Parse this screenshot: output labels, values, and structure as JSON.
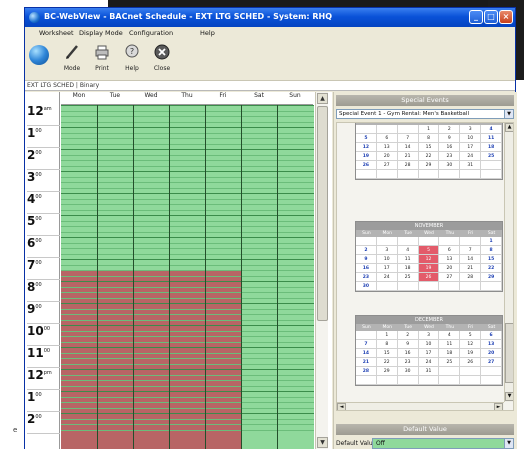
{
  "window": {
    "title": "BC-WebView - BACnet Schedule - EXT LTG SCHED - System: RHQ",
    "min": "_",
    "max": "□",
    "close": "×"
  },
  "menu": [
    "Worksheet",
    "Display Mode",
    "Configuration",
    "Help"
  ],
  "toolbar": [
    {
      "label": "Mode",
      "icon": "pencil-icon"
    },
    {
      "label": "Print",
      "icon": "printer-icon"
    },
    {
      "label": "Help",
      "icon": "help-icon"
    },
    {
      "label": "Close",
      "icon": "close-circle-icon"
    }
  ],
  "tab": "EXT LTG SCHED | Binary",
  "schedule": {
    "days": [
      "Mon",
      "Tue",
      "Wed",
      "Thu",
      "Fri",
      "Sat",
      "Sun"
    ],
    "times": [
      {
        "h": "12",
        "s": "am"
      },
      {
        "h": "1",
        "s": "00"
      },
      {
        "h": "2",
        "s": "00"
      },
      {
        "h": "3",
        "s": "00"
      },
      {
        "h": "4",
        "s": "00"
      },
      {
        "h": "5",
        "s": "00"
      },
      {
        "h": "6",
        "s": "00"
      },
      {
        "h": "7",
        "s": "00"
      },
      {
        "h": "8",
        "s": "00"
      },
      {
        "h": "9",
        "s": "00"
      },
      {
        "h": "10",
        "s": "00"
      },
      {
        "h": "11",
        "s": "00"
      },
      {
        "h": "12",
        "s": "pm"
      },
      {
        "h": "1",
        "s": "00"
      },
      {
        "h": "2",
        "s": "00"
      }
    ],
    "on_color": "#8fd99b",
    "event_color": "#b86565",
    "event_days": [
      "Mon",
      "Tue",
      "Wed",
      "Thu",
      "Fri"
    ],
    "event_start": "7:30"
  },
  "side_letter": "e",
  "special_events": {
    "header": "Special Events",
    "selected": "Special Event 1 - Gym Rental: Men's Basketball",
    "weekday_labels": [
      "Sun",
      "Mon",
      "Tue",
      "Wed",
      "Thu",
      "Fri",
      "Sat"
    ],
    "months": [
      {
        "name": "",
        "weeks": [
          [
            "",
            "",
            "",
            "1",
            "2",
            "3",
            "4"
          ],
          [
            "5",
            "6",
            "7",
            "8",
            "9",
            "10",
            "11"
          ],
          [
            "12",
            "13",
            "14",
            "15",
            "16",
            "17",
            "18"
          ],
          [
            "19",
            "20",
            "21",
            "22",
            "23",
            "24",
            "25"
          ],
          [
            "26",
            "27",
            "28",
            "29",
            "30",
            "31",
            ""
          ],
          [
            "",
            "",
            "",
            "",
            "",
            "",
            ""
          ]
        ],
        "highlights": []
      },
      {
        "name": "NOVEMBER",
        "weeks": [
          [
            "",
            "",
            "",
            "",
            "",
            "",
            "1"
          ],
          [
            "2",
            "3",
            "4",
            "5",
            "6",
            "7",
            "8"
          ],
          [
            "9",
            "10",
            "11",
            "12",
            "13",
            "14",
            "15"
          ],
          [
            "16",
            "17",
            "18",
            "19",
            "20",
            "21",
            "22"
          ],
          [
            "23",
            "24",
            "25",
            "26",
            "27",
            "28",
            "29"
          ],
          [
            "30",
            "",
            "",
            "",
            "",
            "",
            ""
          ]
        ],
        "highlights": [
          "5",
          "12",
          "19",
          "26"
        ]
      },
      {
        "name": "DECEMBER",
        "weeks": [
          [
            "",
            "1",
            "2",
            "3",
            "4",
            "5",
            "6"
          ],
          [
            "7",
            "8",
            "9",
            "10",
            "11",
            "12",
            "13"
          ],
          [
            "14",
            "15",
            "16",
            "17",
            "18",
            "19",
            "20"
          ],
          [
            "21",
            "22",
            "23",
            "24",
            "25",
            "26",
            "27"
          ],
          [
            "28",
            "29",
            "30",
            "31",
            "",
            "",
            ""
          ],
          [
            "",
            "",
            "",
            "",
            "",
            "",
            ""
          ]
        ],
        "highlights": []
      }
    ]
  },
  "default_value": {
    "header": "Default Value",
    "label": "Default Value:",
    "value": "Off"
  }
}
